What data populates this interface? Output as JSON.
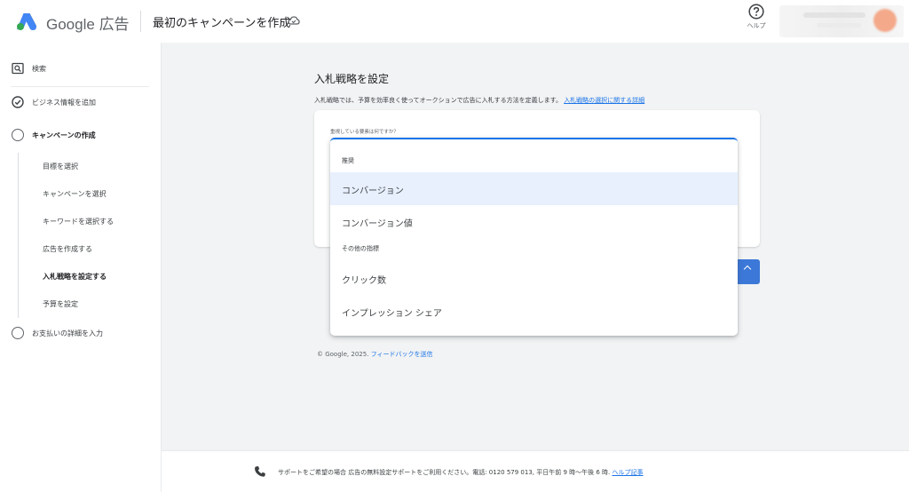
{
  "header": {
    "brand_google": "Google",
    "brand_ads": "広告",
    "campaign_title": "最初のキャンペーンを作成",
    "help_label": "ヘルプ"
  },
  "sidebar": {
    "search": "検索",
    "items": [
      {
        "label": "ビジネス情報を追加",
        "state": "done"
      },
      {
        "label": "キャンペーンの作成",
        "state": "current"
      },
      {
        "label": "お支払いの詳細を入力",
        "state": "todo"
      }
    ],
    "sub_items": [
      {
        "label": "目標を選択"
      },
      {
        "label": "キャンペーンを選択"
      },
      {
        "label": "キーワードを選択する"
      },
      {
        "label": "広告を作成する"
      },
      {
        "label": "入札戦略を設定する",
        "active": true
      },
      {
        "label": "予算を設定"
      }
    ]
  },
  "main": {
    "title": "入札戦略を設定",
    "description": "入札戦略では、予算を効率良く使ってオークションで広告に入札する方法を定義します。",
    "description_link": "入札戦略の選択に関する詳細",
    "question": "重視している要素は何ですか？"
  },
  "dropdown": {
    "group_recommended": "推奨",
    "option_conversions": "コンバージョン",
    "option_conversion_value": "コンバージョン値",
    "group_other": "その他の指標",
    "option_clicks": "クリック数",
    "option_impression_share": "インプレッション シェア"
  },
  "copyright": {
    "text": "© Google, 2025.",
    "feedback_link": "フィードバックを送信"
  },
  "footer": {
    "text": "サポートをご希望の場合 広告の無料設定サポートをご利用ください。電話: 0120 579 013, 平日午前 9 時〜午後 6 時.",
    "link": "ヘルプ記事"
  },
  "colors": {
    "accent": "#1a73e8",
    "button": "#3c78d8",
    "selected_bg": "#e8f0fe"
  }
}
